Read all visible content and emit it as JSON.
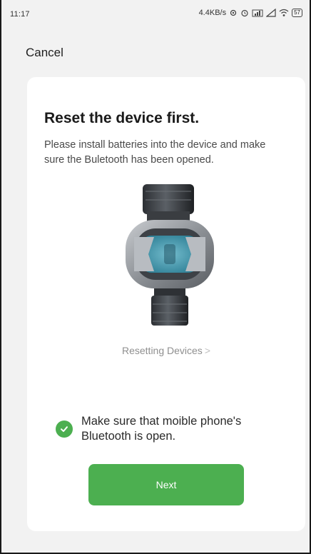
{
  "status_bar": {
    "time": "11:17",
    "speed": "4.4KB/s",
    "battery": "57",
    "icons": [
      "gear-icon",
      "alarm-icon",
      "network-icon",
      "signal-icon",
      "wifi-icon",
      "battery-icon"
    ]
  },
  "header": {
    "cancel_label": "Cancel"
  },
  "main": {
    "title": "Reset the device first.",
    "description": "Please install batteries into the device and make sure the Buletooth has been opened.",
    "device_image": "water-timer-device",
    "reset_link": "Resetting Devices",
    "reset_chevron": ">",
    "checkbox_label": "Make sure that moible phone's Bluetooth is open.",
    "checkbox_checked": true,
    "next_label": "Next"
  },
  "colors": {
    "accent": "#4caf50",
    "background": "#f2f2f2",
    "card": "#ffffff"
  }
}
